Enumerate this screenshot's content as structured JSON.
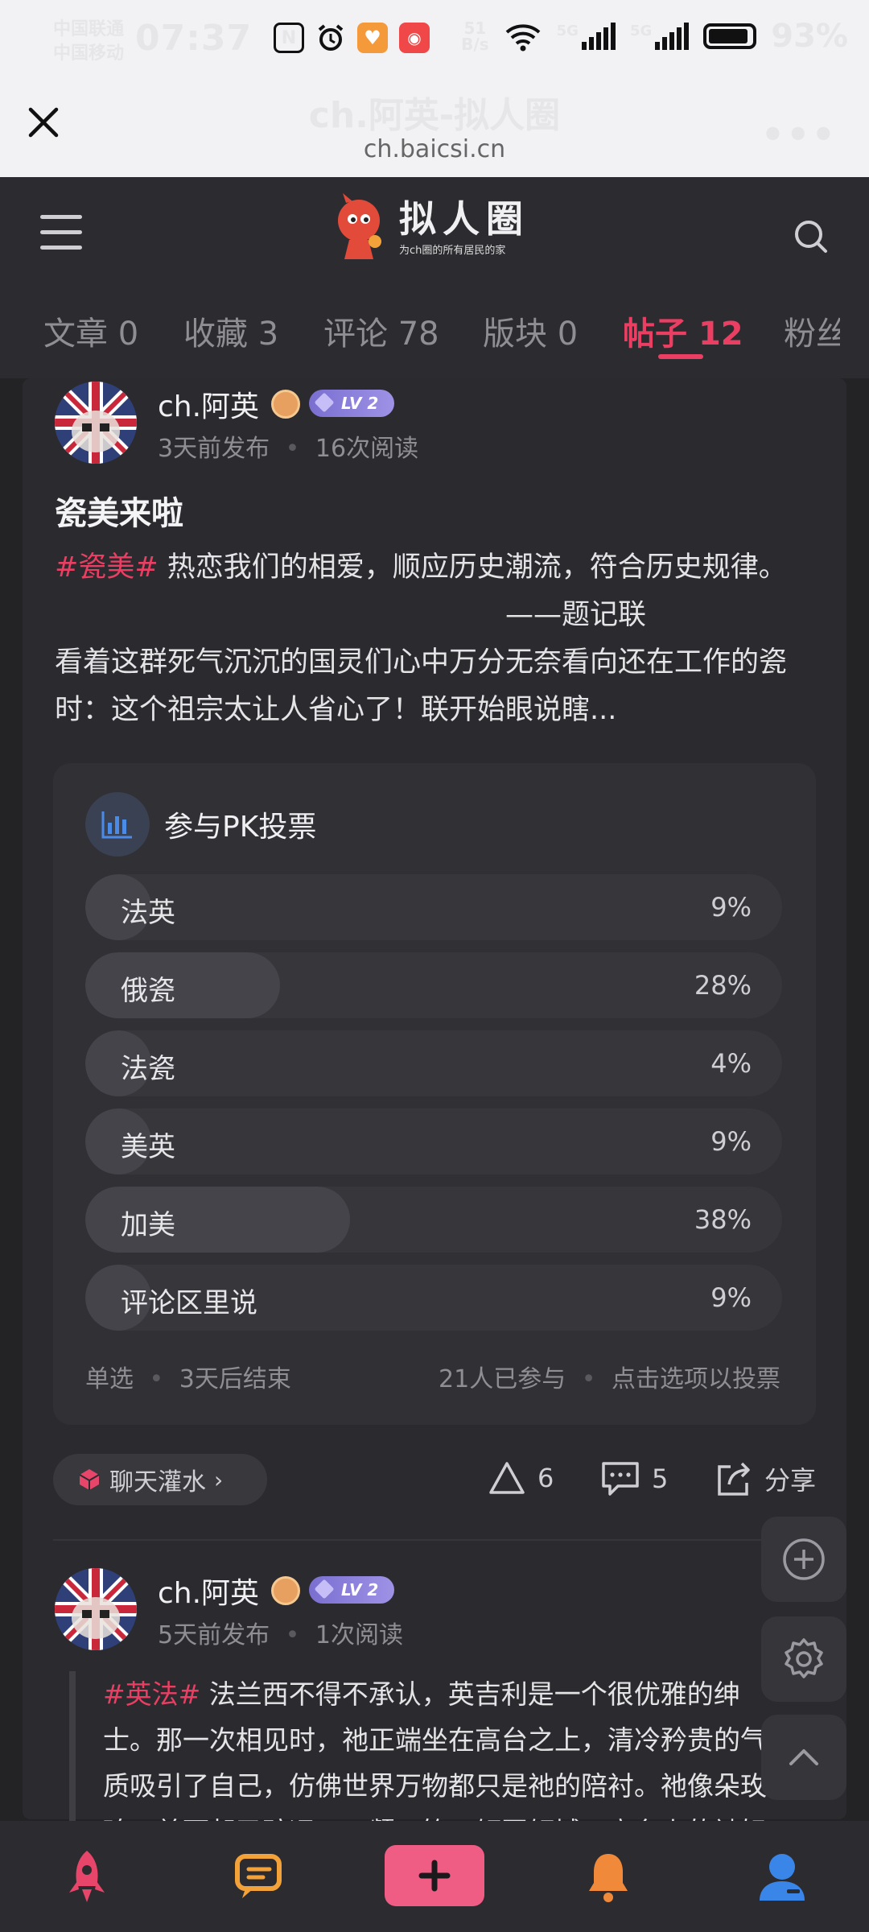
{
  "status_bar": {
    "carrier_1": "中国联通",
    "carrier_2": "中国移动",
    "time": "07:37",
    "net_speed_value": "51",
    "net_speed_unit": "B/s",
    "signal_1_label": "5G",
    "signal_2_label": "5G",
    "battery": "93%"
  },
  "browser": {
    "title": "ch.阿英-拟人圈",
    "url": "ch.baicsi.cn",
    "more_label": "•••"
  },
  "app_header": {
    "logo_title": "拟人圈",
    "logo_subtitle": "为ch圈的所有居民的家"
  },
  "tabs": [
    {
      "label": "文章",
      "count": "0"
    },
    {
      "label": "收藏",
      "count": "3"
    },
    {
      "label": "评论",
      "count": "78"
    },
    {
      "label": "版块",
      "count": "0"
    },
    {
      "label": "帖子",
      "count": "12"
    },
    {
      "label": "粉丝",
      "count": ""
    }
  ],
  "post1": {
    "username": "ch.阿英",
    "level": "LV 2",
    "published": "3天前发布",
    "reads": "16次阅读",
    "title": "瓷美来啦",
    "hashtag": "#瓷美#",
    "body_1": " 热恋我们的相爱，顺应历史潮流，符合历史规律。",
    "signature": "——题记联",
    "body_2": "看着这群死气沉沉的国灵们心中万分无奈看向还在工作的瓷时：这个祖宗太让人省心了！联开始眼说瞎...",
    "poll": {
      "title": "参与PK投票",
      "options": [
        {
          "label": "法英",
          "pct": "9%",
          "value": 0.09
        },
        {
          "label": "俄瓷",
          "pct": "28%",
          "value": 0.28
        },
        {
          "label": "法瓷",
          "pct": "4%",
          "value": 0.04
        },
        {
          "label": "美英",
          "pct": "9%",
          "value": 0.09
        },
        {
          "label": "加美",
          "pct": "38%",
          "value": 0.38
        },
        {
          "label": "评论区里说",
          "pct": "9%",
          "value": 0.09
        }
      ],
      "mode": "单选",
      "ends": "3天后结束",
      "participants": "21人已参与",
      "hint": "点击选项以投票"
    },
    "topic": "聊天灌水",
    "likes": "6",
    "comments": "5",
    "share": "分享"
  },
  "post2": {
    "username": "ch.阿英",
    "level": "LV 2",
    "published": "5天前发布",
    "reads": "1次阅读",
    "hashtag": "#英法#",
    "body": " 法兰西不得不承认，英吉利是一个很优雅的绅士。那一次相见时，祂正端坐在高台之上，清冷矜贵的气质吸引了自己，仿佛世界万物都只是祂的陪衬。祂像朵玫瑰，美丽却又疏远，一颦一笑，倾国倾城，高台上的祂好"
  },
  "colors": {
    "accent": "#ea3f63",
    "background": "#232326",
    "card": "#2b2b2f"
  }
}
